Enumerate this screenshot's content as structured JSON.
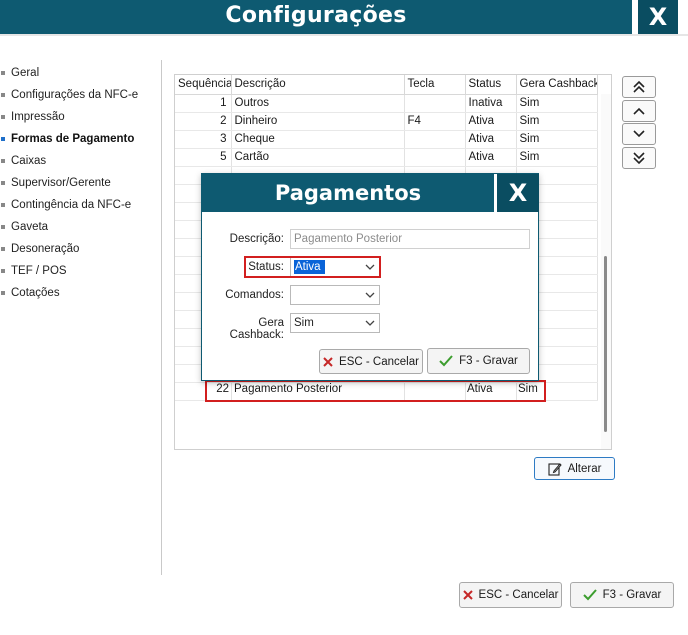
{
  "window": {
    "title": "Configurações",
    "close_label": "X"
  },
  "sidebar": {
    "items": [
      {
        "label": "Geral",
        "active": false
      },
      {
        "label": "Configurações da NFC-e",
        "active": false
      },
      {
        "label": "Impressão",
        "active": false
      },
      {
        "label": "Formas de Pagamento",
        "active": true
      },
      {
        "label": "Caixas",
        "active": false
      },
      {
        "label": "Supervisor/Gerente",
        "active": false
      },
      {
        "label": "Contingência da NFC-e",
        "active": false
      },
      {
        "label": "Gaveta",
        "active": false
      },
      {
        "label": "Desoneração",
        "active": false
      },
      {
        "label": "TEF / POS",
        "active": false
      },
      {
        "label": "Cotações",
        "active": false
      }
    ]
  },
  "grid": {
    "columns": [
      "Sequência",
      "Descrição",
      "Tecla",
      "Status",
      "Gera Cashback"
    ],
    "rows": [
      [
        "1",
        "Outros",
        "",
        "Inativa",
        "Sim"
      ],
      [
        "2",
        "Dinheiro",
        "F4",
        "Ativa",
        "Sim"
      ],
      [
        "3",
        "Cheque",
        "",
        "Ativa",
        "Sim"
      ],
      [
        "5",
        "Cartão",
        "",
        "Ativa",
        "Sim"
      ]
    ],
    "highlighted_row": [
      "22",
      "Pagamento Posterior",
      "",
      "Ativa",
      "Sim"
    ]
  },
  "nav_buttons": [
    "first-icon",
    "up-icon",
    "down-icon",
    "last-icon"
  ],
  "alterar_label": "Alterar",
  "footer": {
    "cancel_label": "ESC - Cancelar",
    "save_label": "F3 - Gravar"
  },
  "modal": {
    "title": "Pagamentos",
    "close_label": "X",
    "descricao_label": "Descrição:",
    "descricao_value": "Pagamento Posterior",
    "status_label": "Status:",
    "status_value": "Ativa",
    "comandos_label": "Comandos:",
    "comandos_value": "",
    "cashback_label": "Gera Cashback:",
    "cashback_value": "Sim",
    "cancel_label": "ESC - Cancelar",
    "save_label": "F3 - Gravar"
  },
  "colors": {
    "header": "#0e5a71",
    "highlight": "#d21f1f",
    "accent": "#1f6fc9"
  }
}
